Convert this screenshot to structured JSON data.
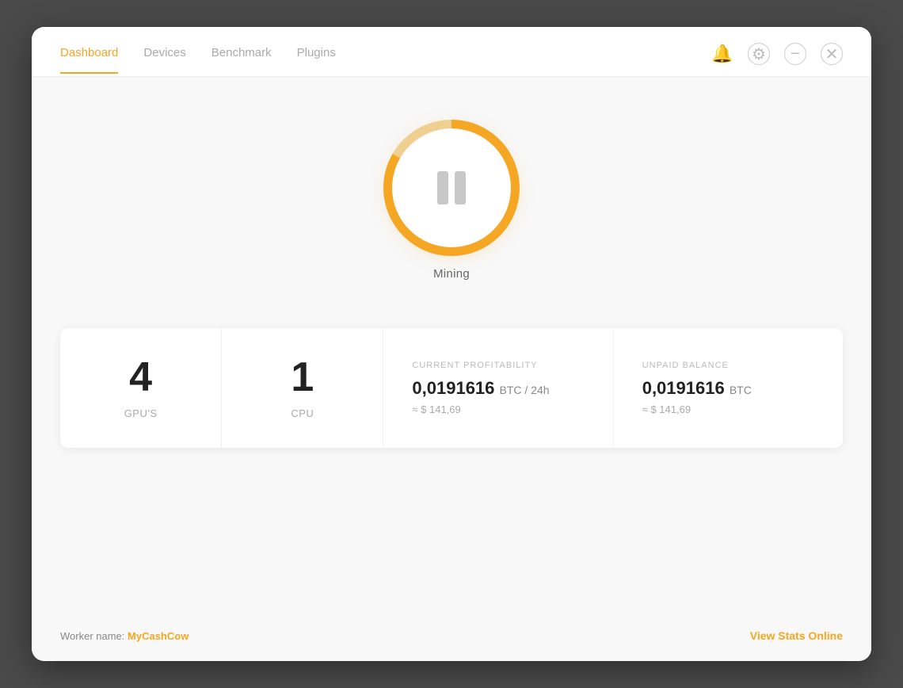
{
  "navbar": {
    "items": [
      {
        "id": "dashboard",
        "label": "Dashboard",
        "active": true
      },
      {
        "id": "devices",
        "label": "Devices",
        "active": false
      },
      {
        "id": "benchmark",
        "label": "Benchmark",
        "active": false
      },
      {
        "id": "plugins",
        "label": "Plugins",
        "active": false
      }
    ],
    "icons": {
      "bell": "🔔",
      "settings": "⚙",
      "minimize": "−",
      "close": "✕"
    }
  },
  "mining": {
    "status_label": "Mining"
  },
  "stats": [
    {
      "id": "gpus",
      "number": "4",
      "label": "GPU'S"
    },
    {
      "id": "cpu",
      "number": "1",
      "label": "CPU"
    }
  ],
  "profitability": {
    "title": "CURRENT PROFITABILITY",
    "value": "0,0191616",
    "unit": "BTC / 24h",
    "sub": "≈ $ 141,69"
  },
  "balance": {
    "title": "UNPAID BALANCE",
    "value": "0,0191616",
    "unit": "BTC",
    "sub": "≈ $ 141,69"
  },
  "footer": {
    "worker_prefix": "Worker name: ",
    "worker_name": "MyCashCow",
    "view_stats": "View Stats Online"
  }
}
